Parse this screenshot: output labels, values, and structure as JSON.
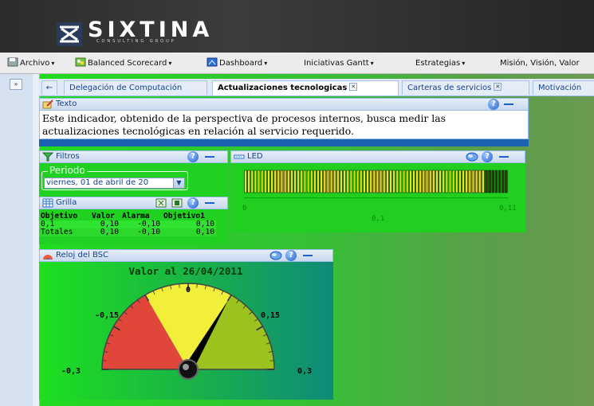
{
  "brand": {
    "name": "SIXTINA",
    "tagline": "CONSULTING GROUP"
  },
  "menu": [
    {
      "label": "Archivo",
      "icon": "save-icon"
    },
    {
      "label": "Balanced Scorecard",
      "icon": "scorecard-icon"
    },
    {
      "label": "Dashboard",
      "icon": "dashboard-icon"
    },
    {
      "label": "Iniciativas Gantt"
    },
    {
      "label": "Estrategias"
    },
    {
      "label": "Misión, Visión, Valor"
    }
  ],
  "rail": {
    "expand_label": "»"
  },
  "tabs": [
    {
      "label": "Delegación de Computación"
    },
    {
      "label": "Actualizaciones tecnologicas",
      "active": true
    },
    {
      "label": "Carteras de servicios"
    },
    {
      "label": "Motivación"
    }
  ],
  "texto": {
    "title": "Texto",
    "body": "Este indicador, obtenido de la perspectiva de procesos internos, busca medir las actualizaciones tecnológicas en relación al servicio requerido."
  },
  "filtros": {
    "title": "Filtros",
    "periodo_label": "Periodo",
    "periodo_value": "viernes, 01 de abril de 20"
  },
  "grilla": {
    "title": "Grilla",
    "columns": [
      "Objetivo",
      "Valor",
      "Alarma",
      "Objetivo1"
    ],
    "rows": [
      [
        "0,1",
        "0,10",
        "-0,10",
        "0,10"
      ],
      [
        "Totales",
        "0,10",
        "-0,10",
        "0,10"
      ]
    ]
  },
  "led": {
    "title": "LED",
    "min_label": "0",
    "max_label": "0,11",
    "value_label": "0,1",
    "value": 0.1,
    "min": 0,
    "max": 0.11
  },
  "reloj": {
    "title": "Reloj del BSC",
    "caption": "Valor al 26/04/2011",
    "labels": {
      "min": "-0,3",
      "lowmid": "-0,15",
      "zero": "0",
      "highmid": "0,15",
      "max": "0,3"
    },
    "value": 0.1,
    "min": -0.3,
    "max": 0.3,
    "bands": [
      {
        "from": -0.3,
        "to": -0.1,
        "color": "#e0463a"
      },
      {
        "from": -0.1,
        "to": 0.1,
        "color": "#f2ef3a"
      },
      {
        "from": 0.1,
        "to": 0.3,
        "color": "#9cc21e"
      }
    ]
  },
  "colors": {
    "panel_green": "#21d121",
    "accent_blue": "#15428b",
    "header_bg": "#2c2c2c"
  }
}
